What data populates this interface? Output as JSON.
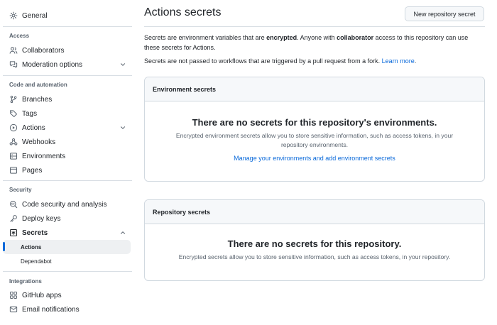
{
  "sidebar": {
    "general": "General",
    "access_title": "Access",
    "collaborators": "Collaborators",
    "moderation": "Moderation options",
    "code_title": "Code and automation",
    "branches": "Branches",
    "tags": "Tags",
    "actions": "Actions",
    "webhooks": "Webhooks",
    "environments": "Environments",
    "pages": "Pages",
    "security_title": "Security",
    "code_security": "Code security and analysis",
    "deploy_keys": "Deploy keys",
    "secrets": "Secrets",
    "secrets_actions": "Actions",
    "secrets_dependabot": "Dependabot",
    "integrations_title": "Integrations",
    "github_apps": "GitHub apps",
    "email_notifications": "Email notifications"
  },
  "main": {
    "title": "Actions secrets",
    "new_button": "New repository secret",
    "intro": {
      "p1_a": "Secrets are environment variables that are ",
      "p1_b": "encrypted",
      "p1_c": ". Anyone with ",
      "p1_d": "collaborator",
      "p1_e": " access to this repository can use these secrets for Actions.",
      "p2_a": "Secrets are not passed to workflows that are triggered by a pull request from a fork. ",
      "p2_link": "Learn more",
      "p2_end": "."
    },
    "env_box": {
      "header": "Environment secrets",
      "title": "There are no secrets for this repository's environments.",
      "desc": "Encrypted environment secrets allow you to store sensitive information, such as access tokens, in your repository environments.",
      "link": "Manage your environments and add environment secrets"
    },
    "repo_box": {
      "header": "Repository secrets",
      "title": "There are no secrets for this repository.",
      "desc": "Encrypted secrets allow you to store sensitive information, such as access tokens, in your repository."
    }
  },
  "colors": {
    "accent": "#0969da",
    "border": "#d1d9e0",
    "muted": "#59636e"
  }
}
